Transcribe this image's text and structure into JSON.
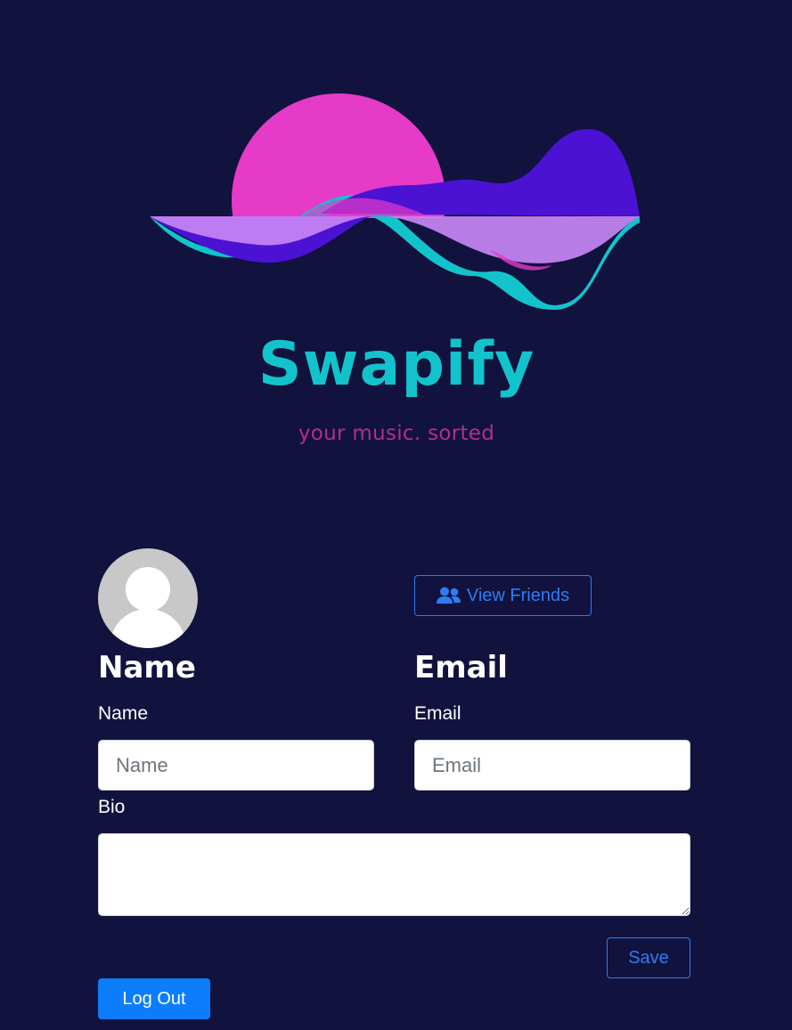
{
  "brand": {
    "name": "Swapify",
    "tagline": "your music. sorted"
  },
  "profile": {
    "view_friends_label": "View Friends",
    "name_heading": "Name",
    "email_heading": "Email",
    "name_label": "Name",
    "name_placeholder": "Name",
    "name_value": "",
    "email_label": "Email",
    "email_placeholder": "Email",
    "email_value": "",
    "bio_label": "Bio",
    "bio_value": "",
    "save_label": "Save",
    "logout_label": "Log Out"
  },
  "colors": {
    "background": "#11123d",
    "brand_teal": "#12c3cc",
    "brand_magenta": "#b02f8f",
    "accent_blue": "#2d7cf6",
    "primary_button": "#0d7dfb"
  },
  "icons": {
    "friends_button_icon": "users-icon",
    "avatar_icon": "user-silhouette-icon"
  }
}
